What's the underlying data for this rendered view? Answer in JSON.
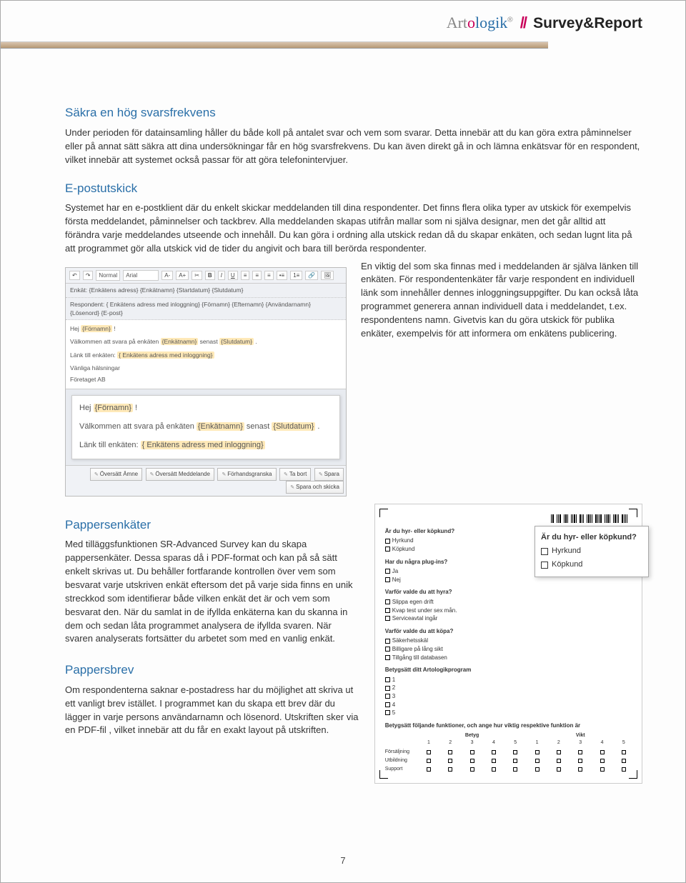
{
  "logo": {
    "part1": "Art",
    "part_o": "o",
    "part2": "logik",
    "reg": "®",
    "slashes": "//",
    "product": "Survey&Report"
  },
  "sections": {
    "s1": {
      "title": "Säkra en hög svarsfrekvens",
      "body": "Under perioden för datainsamling håller du både koll på antalet svar och vem som svarar. Detta innebär att du kan göra extra påminnelser eller på annat sätt säkra att dina undersökningar får en hög svarsfrekvens. Du kan även direkt gå in och lämna enkätsvar för en respondent, vilket innebär att systemet också passar för att göra telefonintervjuer."
    },
    "s2": {
      "title": "E-postutskick",
      "body1": "Systemet har en e-postklient där du enkelt skickar meddelanden till dina respondenter. Det finns flera olika typer av utskick för exempelvis första meddelandet, påminnelser och tackbrev. Alla meddelanden skapas utifrån mallar som ni själva designar, men det går alltid att förändra varje meddelandes utseende och innehåll. Du kan göra i ordning alla utskick redan då du skapar enkäten, och sedan lugnt lita på att programmet gör alla utskick vid de tider du angivit och bara till berörda respondenter.",
      "body2": "En viktig del som ska finnas med i meddelanden är själva länken till enkäten. För respondentenkäter får varje respondent en individuell länk som innehåller dennes inloggningsuppgifter. Du kan också låta programmet generera annan individuell data i meddelandet, t.ex. respondentens namn. Givetvis kan du göra utskick för publika enkäter, exempelvis för att informera om enkätens publicering."
    },
    "s3": {
      "title": "Pappersenkäter",
      "body": "Med tilläggsfunktionen SR-Advanced Survey kan du skapa pappersenkäter. Dessa sparas då i PDF-format och kan på så sätt enkelt skrivas ut. Du behåller fortfarande kontrollen över vem som besvarat varje utskriven enkät eftersom det på varje sida finns en unik streckkod som identifierar både vilken enkät det är och vem som besvarat den. När du samlat in de ifyllda enkäterna kan du skanna in dem och sedan låta programmet analysera de ifyllda svaren. När svaren analyserats fortsätter du arbetet som med en vanlig enkät."
    },
    "s4": {
      "title": "Pappersbrev",
      "body": "Om respondenterna saknar e-postadress har du möjlighet att skriva ut ett vanligt brev istället. I programmet kan du skapa ett brev där du lägger in varje persons användarnamn och lösenord. Utskriften sker via en PDF-fil , vilket innebär att du får en exakt layout på utskriften."
    }
  },
  "editor": {
    "toolbar": {
      "normal": "Normal",
      "font": "Arial"
    },
    "row_enkat_label": "Enkät:",
    "row_enkat_value": "{Enkätens adress} {Enkätnamn} {Startdatum} {Slutdatum}",
    "row_resp_label": "Respondent:",
    "row_resp_value": "{ Enkätens adress med inloggning} {Förnamn} {Efternamn} {Användarnamn} {Lösenord} {E-post}",
    "area_line1_pre": "Hej ",
    "area_line1_tag": "{Förnamn}",
    "area_line1_post": " !",
    "area_line2_pre": "Välkommen att svara på enkäten ",
    "area_line2_tag1": "{Enkätnamn}",
    "area_line2_mid": " senast ",
    "area_line2_tag2": "{Slutdatum}",
    "area_line2_post": " .",
    "area_line3_pre": "Länk till enkäten: ",
    "area_line3_tag": "{ Enkätens adress med inloggning}",
    "area_line4": "Vänliga hälsningar",
    "area_line5": "Företaget AB",
    "preview_line1_pre": "Hej ",
    "preview_line1_tag": "{Förnamn}",
    "preview_line1_post": " !",
    "preview_line2_pre": "Välkommen att svara på enkäten ",
    "preview_line2_tag1": "{Enkätnamn}",
    "preview_line2_mid": " senast ",
    "preview_line2_tag2": "{Slutdatum}",
    "preview_line2_post": " .",
    "preview_line3_pre": "Länk till enkäten: ",
    "preview_line3_tag": "{ Enkätens adress med inloggning}",
    "footer_buttons": [
      "Översätt Ämne",
      "Översätt Meddelande",
      "Förhandsgranska",
      "Ta bort",
      "Spara",
      "Spara och skicka"
    ]
  },
  "paper_survey": {
    "q1": "Är du hyr- eller köpkund?",
    "q1_opts": [
      "Hyrkund",
      "Köpkund"
    ],
    "q2": "Har du några plug-ins?",
    "q2_opts": [
      "Ja",
      "Nej"
    ],
    "q3": "Varför valde du att hyra?",
    "q3_opts": [
      "Slippa egen drift",
      "Kvap test under sex mån.",
      "Serviceavtal ingår"
    ],
    "q4": "Varför valde du att köpa?",
    "q4_opts": [
      "Säkerhetsskäl",
      "Billigare på lång sikt",
      "Tillgång till databasen"
    ],
    "q5": "Betygsätt ditt Artologikprogram",
    "q5_opts": [
      "1",
      "2",
      "3",
      "4",
      "5"
    ],
    "q6": "Betygsätt följande funktioner, och ange hur viktig respektive funktion är",
    "q6_groups": [
      "Betyg",
      "Vikt"
    ],
    "q6_nums": [
      "1",
      "2",
      "3",
      "4",
      "5"
    ],
    "q6_rows": [
      "Försäljning",
      "Utbildning",
      "Support"
    ],
    "zoom_title": "Är du hyr- eller köpkund?",
    "zoom_opts": [
      "Hyrkund",
      "Köpkund"
    ]
  },
  "page_number": "7"
}
